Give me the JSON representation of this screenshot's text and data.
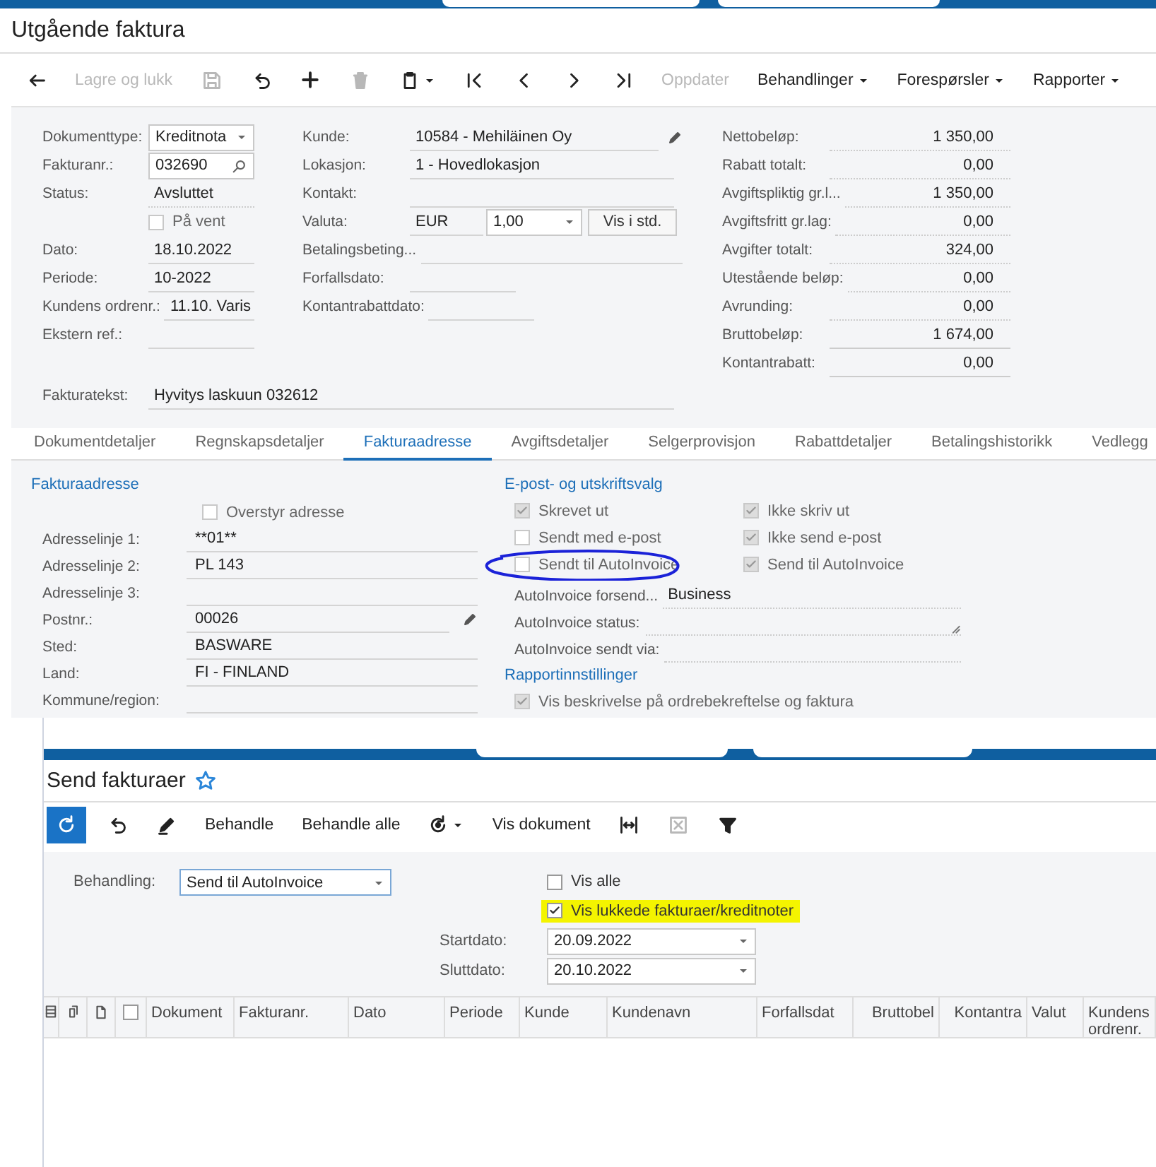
{
  "invoice": {
    "title": "Utgående faktura",
    "toolbar": [
      {
        "kind": "icon",
        "disabled": false
      },
      {
        "kind": "text",
        "label": "Lagre og lukk",
        "disabled": true
      },
      {
        "kind": "icon",
        "disabled": true
      },
      {
        "kind": "icon",
        "disabled": false
      },
      {
        "kind": "icon",
        "disabled": false
      },
      {
        "kind": "icon",
        "disabled": true
      },
      {
        "kind": "icon_menu",
        "disabled": false
      },
      {
        "kind": "icon",
        "disabled": false
      },
      {
        "kind": "icon",
        "disabled": false
      },
      {
        "kind": "icon",
        "disabled": false
      },
      {
        "kind": "icon",
        "disabled": false
      },
      {
        "kind": "text",
        "label": "Oppdater",
        "disabled": true
      },
      {
        "kind": "menu",
        "label": "Behandlinger",
        "disabled": false
      },
      {
        "kind": "menu",
        "label": "Forespørsler",
        "disabled": false
      },
      {
        "kind": "menu",
        "label": "Rapporter",
        "disabled": false
      }
    ],
    "summary": {
      "column_1": [
        {
          "kind": "select",
          "label": "Dokumenttype:",
          "value": "Kreditnota"
        },
        {
          "kind": "lookup",
          "label": "Fakturanr.:",
          "value": "032690"
        },
        {
          "kind": "readonly",
          "label": "Status:",
          "value": "Avsluttet"
        },
        {
          "kind": "checkbox",
          "label": "På vent",
          "checked": false
        },
        {
          "kind": "text",
          "label": "Dato:",
          "value": "18.10.2022"
        },
        {
          "kind": "text",
          "label": "Periode:",
          "value": "10-2022"
        },
        {
          "kind": "text",
          "label": "Kundens ordrenr.:",
          "value": "11.10. Varis"
        },
        {
          "kind": "text",
          "label": "Ekstern ref.:"
        }
      ],
      "column_2": [
        {
          "kind": "edit",
          "label": "Kunde:",
          "value": "10584 - Mehiläinen Oy"
        },
        {
          "kind": "text",
          "label": "Lokasjon:",
          "value": "1 - Hovedlokasjon"
        },
        {
          "kind": "text",
          "label": "Kontakt:"
        },
        {
          "kind": "currency",
          "label": "Valuta:",
          "value": "EUR",
          "rate": "1,00",
          "button": "Vis i std."
        },
        {
          "kind": "text",
          "label": "Betalingsbeting..."
        },
        {
          "kind": "short",
          "label": "Forfallsdato:"
        },
        {
          "kind": "short",
          "label": "Kontantrabattdato:"
        }
      ],
      "totals": [
        {
          "label": "Nettobeløp:",
          "value": "1 350,00"
        },
        {
          "label": "Rabatt totalt:",
          "value": "0,00"
        },
        {
          "label": "Avgiftspliktig gr.l...",
          "value": "1 350,00"
        },
        {
          "label": "Avgiftsfritt gr.lag:",
          "value": "0,00"
        },
        {
          "label": "Avgifter totalt:",
          "value": "324,00"
        },
        {
          "label": "Utestående beløp:",
          "value": "0,00"
        },
        {
          "label": "Avrunding:",
          "value": "0,00"
        },
        {
          "label": "Bruttobeløp:",
          "value": "1 674,00"
        },
        {
          "label": "Kontantrabatt:",
          "value": "0,00"
        }
      ],
      "invoice_text": {
        "label": "Fakturatekst:",
        "value": "Hyvitys laskuun 032612"
      }
    },
    "tabs": [
      {
        "label": "Dokumentdetaljer",
        "selected": false
      },
      {
        "label": "Regnskapsdetaljer",
        "selected": false
      },
      {
        "label": "Fakturaadresse",
        "selected": true
      },
      {
        "label": "Avgiftsdetaljer",
        "selected": false
      },
      {
        "label": "Selgerprovisjon",
        "selected": false
      },
      {
        "label": "Rabattdetaljer",
        "selected": false
      },
      {
        "label": "Betalingshistorikk",
        "selected": false
      },
      {
        "label": "Vedlegg",
        "selected": false
      }
    ],
    "address": {
      "heading": "Fakturaadresse",
      "override": {
        "label": "Overstyr adresse",
        "checked": false
      },
      "fields": [
        {
          "kind": "text",
          "label": "Adresselinje 1:",
          "value": "**01**"
        },
        {
          "kind": "text",
          "label": "Adresselinje 2:",
          "value": "PL 143"
        },
        {
          "kind": "text",
          "label": "Adresselinje 3:"
        },
        {
          "kind": "edit",
          "label": "Postnr.:",
          "value": "00026"
        },
        {
          "kind": "text",
          "label": "Sted:",
          "value": "BASWARE"
        },
        {
          "kind": "text",
          "label": "Land:",
          "value": "FI - FINLAND"
        },
        {
          "kind": "text",
          "label": "Kommune/region:"
        }
      ]
    },
    "delivery": {
      "heading": "E-post- og utskriftsvalg",
      "checkboxes": [
        {
          "label": "Skrevet ut",
          "checked": true,
          "disabled": true,
          "annotated": false
        },
        {
          "label": "Ikke skriv ut",
          "checked": true,
          "disabled": true,
          "annotated": false
        },
        {
          "label": "Sendt med e-post",
          "checked": false,
          "disabled": true,
          "annotated": false
        },
        {
          "label": "Ikke send e-post",
          "checked": true,
          "disabled": true,
          "annotated": false
        },
        {
          "label": "Sendt til AutoInvoice",
          "checked": false,
          "disabled": true,
          "annotated": true
        },
        {
          "label": "Send til AutoInvoice",
          "checked": true,
          "disabled": true,
          "annotated": false
        }
      ],
      "fields": [
        {
          "kind": "text",
          "label": "AutoInvoice forsend...",
          "value": "Business"
        },
        {
          "kind": "textarea",
          "label": "AutoInvoice status:"
        },
        {
          "kind": "text",
          "label": "AutoInvoice sendt via:"
        }
      ],
      "report_heading": "Rapportinnstillinger",
      "report_options": [
        {
          "label": "Vis beskrivelse på ordrebekreftelse og faktura",
          "checked": true,
          "disabled": true
        }
      ]
    }
  },
  "send": {
    "title": "Send fakturaer",
    "favorite": false,
    "toolbar": [
      {
        "kind": "primary",
        "disabled": false
      },
      {
        "kind": "icon",
        "disabled": false
      },
      {
        "kind": "icon",
        "disabled": false
      },
      {
        "kind": "text",
        "label": "Behandle",
        "disabled": false
      },
      {
        "kind": "text",
        "label": "Behandle alle",
        "disabled": false
      },
      {
        "kind": "icon_menu",
        "disabled": false
      },
      {
        "kind": "text",
        "label": "Vis dokument",
        "disabled": false
      },
      {
        "kind": "icon",
        "disabled": false
      },
      {
        "kind": "icon",
        "disabled": true
      },
      {
        "kind": "icon",
        "disabled": false
      }
    ],
    "filter": {
      "action": {
        "label": "Behandling:",
        "value": "Send til AutoInvoice"
      },
      "options": [
        {
          "label": "Vis alle",
          "checked": false,
          "highlighted": false
        },
        {
          "label": "Vis lukkede fakturaer/kreditnoter",
          "checked": true,
          "highlighted": true
        }
      ],
      "dates": [
        {
          "label": "Startdato:",
          "value": "20.09.2022"
        },
        {
          "label": "Sluttdato:",
          "value": "20.10.2022"
        }
      ]
    },
    "grid": {
      "select_all_checked": false,
      "columns": [
        {
          "label": "Dokument",
          "kind": "text"
        },
        {
          "label": "Fakturanr.",
          "kind": "text"
        },
        {
          "label": "Dato",
          "kind": "text"
        },
        {
          "label": "Periode",
          "kind": "text"
        },
        {
          "label": "Kunde",
          "kind": "text"
        },
        {
          "label": "Kundenavn",
          "kind": "text"
        },
        {
          "label": "Forfallsdat",
          "kind": "text"
        },
        {
          "label": "Bruttobel",
          "kind": "number"
        },
        {
          "label": "Kontantra",
          "kind": "number"
        },
        {
          "label": "Valut",
          "kind": "text"
        },
        {
          "label": "Kundens ordrenr.",
          "kind": "text"
        }
      ]
    }
  }
}
